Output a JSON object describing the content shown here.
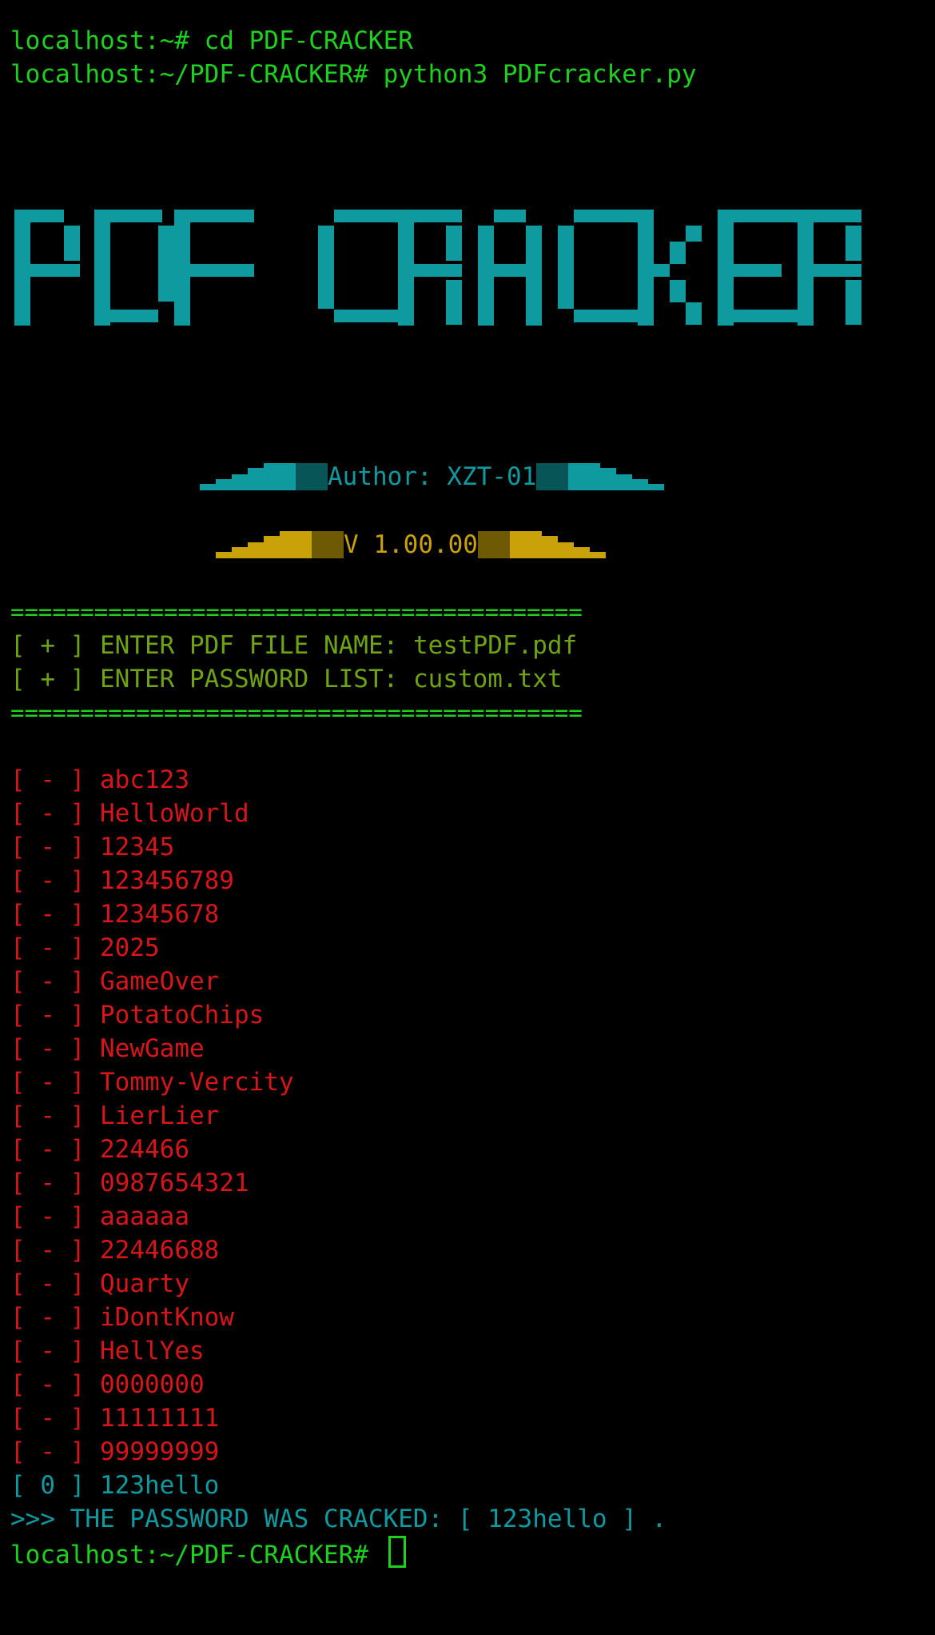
{
  "prompt_host": "localhost:~#",
  "cmd1": " cd PDF-CRACKER",
  "prompt_dir": "localhost:~/PDF-CRACKER#",
  "cmd2": " python3 PDFcracker.py",
  "banner_text": "PDF CRACKER",
  "author": "Author: XZT-01",
  "version": " V 1.00.00 ",
  "separator": "=========================================",
  "inputs": [
    {
      "tag": "[ + ]",
      "label": "ENTER PDF FILE NAME:",
      "value": "testPDF.pdf"
    },
    {
      "tag": "[ + ]",
      "label": "ENTER PASSWORD LIST:",
      "value": "custom.txt"
    }
  ],
  "fail_tag": "[ - ]",
  "attempts": [
    "abc123",
    "HelloWorld",
    "12345",
    "123456789",
    "12345678",
    "2025",
    "GameOver",
    "PotatoChips",
    "NewGame",
    "Tommy-Vercity",
    "LierLier",
    "224466",
    "0987654321",
    "aaaaaa",
    "22446688",
    "Quarty",
    "iDontKnow",
    "HellYes",
    "0000000",
    "11111111",
    "99999999"
  ],
  "success_tag": "[ 0 ]",
  "success_value": "123hello",
  "result_line": ">>> THE PASSWORD WAS CRACKED: [ 123hello ] .",
  "colors": {
    "prompt": "#1fd11f",
    "input": "#6fa313",
    "fail": "#d6161a",
    "success": "#0f9aa0",
    "version": "#c9a20a"
  }
}
